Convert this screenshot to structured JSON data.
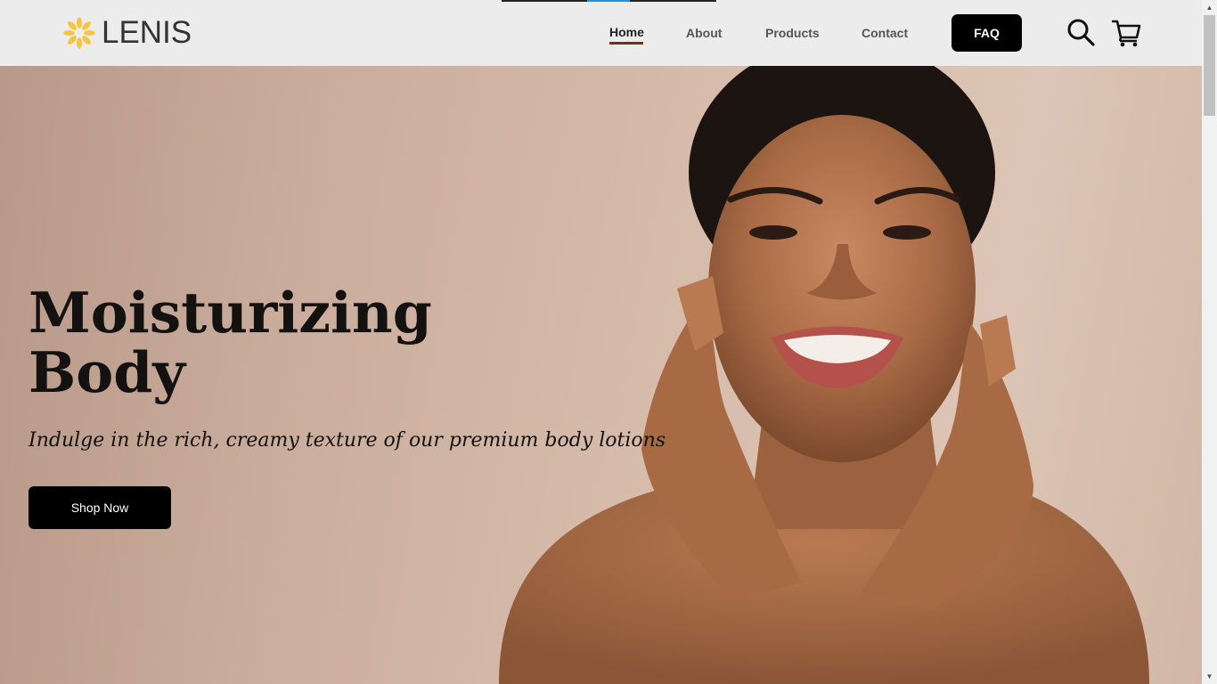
{
  "brand": {
    "name": "LENIS",
    "logo_color": "#f5c542"
  },
  "nav": {
    "items": [
      {
        "label": "Home",
        "active": true
      },
      {
        "label": "About",
        "active": false
      },
      {
        "label": "Products",
        "active": false
      },
      {
        "label": "Contact",
        "active": false
      }
    ],
    "faq_label": "FAQ",
    "search_icon": "search-icon",
    "cart_icon": "cart-icon",
    "active_underline_color": "#7a2e1a"
  },
  "hero": {
    "title_line1": "Moisturizing",
    "title_line2": "Body",
    "subtitle": "Indulge in the rich, creamy texture of our premium body lotions",
    "cta_label": "Shop Now",
    "image_description_icon": "smiling-woman-photo"
  },
  "colors": {
    "header_bg": "#ececec",
    "button_bg": "#000000",
    "hero_bg": "#d2b7a6"
  }
}
